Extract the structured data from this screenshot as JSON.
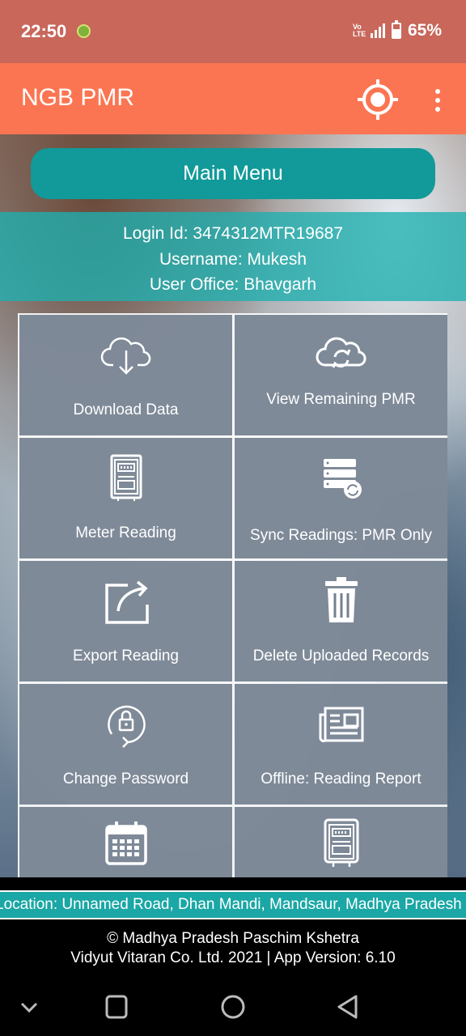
{
  "status_bar": {
    "time": "22:50",
    "network": "LTE",
    "volte": "Vo LTE",
    "battery_percent": "65%",
    "battery_level": 0.65,
    "icons": [
      "app-notification-icon",
      "volte-icon",
      "signal-icon",
      "battery-icon"
    ]
  },
  "app_bar": {
    "title": "NGB PMR",
    "actions": [
      "locate-icon",
      "more-vert-icon"
    ]
  },
  "main_menu": {
    "label": "Main Menu"
  },
  "user_info": {
    "login_id": "Login Id: 3474312MTR19687",
    "username": "Username: Mukesh",
    "office": "User Office: Bhavgarh"
  },
  "tiles": [
    {
      "label": "Download Data",
      "icon": "cloud-download-icon"
    },
    {
      "label": "View Remaining PMR",
      "icon": "cloud-sync-icon"
    },
    {
      "label": "Meter Reading",
      "icon": "meter-icon"
    },
    {
      "label": "Sync Readings: PMR Only",
      "icon": "server-sync-icon"
    },
    {
      "label": "Export Reading",
      "icon": "share-icon"
    },
    {
      "label": "Delete Uploaded Records",
      "icon": "trash-icon"
    },
    {
      "label": "Change Password",
      "icon": "lock-refresh-icon"
    },
    {
      "label": "Offline: Reading Report",
      "icon": "newspaper-icon"
    },
    {
      "label": "",
      "icon": "calendar-icon"
    },
    {
      "label": "",
      "icon": "meter-icon"
    }
  ],
  "location": {
    "text": "Location: Unnamed Road, Dhan Mandi, Mandsaur, Madhya Pradesh"
  },
  "footer": {
    "line1": "© Madhya Pradesh Paschim Kshetra",
    "line2": "Vidyut Vitaran Co. Ltd. 2021 | App Version: 6.10"
  },
  "colors": {
    "status_bar": "#c8675a",
    "app_bar": "#fb7552",
    "accent_teal": "#119a99",
    "tile": "#74808f"
  },
  "nav": {
    "buttons": [
      "chevron-down-icon",
      "recents-icon",
      "home-icon",
      "back-icon"
    ]
  }
}
